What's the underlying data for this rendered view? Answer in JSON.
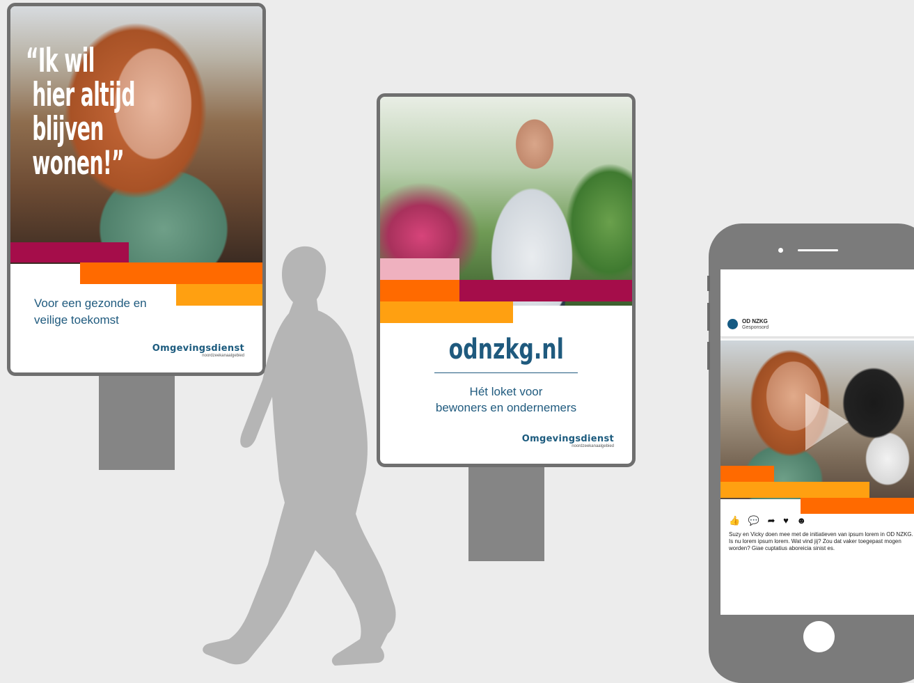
{
  "colors": {
    "background": "#ececec",
    "frame": "#6f6f6f",
    "post": "#858585",
    "brand_blue": "#1f5a7e",
    "magenta": "#a50d4a",
    "orange": "#ff6a00",
    "amber": "#ffa011",
    "pink": "#efb1bf"
  },
  "billboard_left": {
    "quote": "“Ik wil\n hier altijd\n blijven\n wonen!”",
    "tagline_line1": "Voor een gezonde en",
    "tagline_line2": "veilige toekomst",
    "logo": "Omgevingsdienst",
    "logo_sub": "noordzeekanaalgebied"
  },
  "billboard_middle": {
    "url": "odnzkg.nl",
    "sub_line1": "Hét loket voor",
    "sub_line2": "bewoners en ondernemers",
    "logo": "Omgevingsdienst",
    "logo_sub": "noordzeekanaalgebied"
  },
  "phone_post": {
    "account_name": "OD NZKG",
    "sponsored": "Gesponsord",
    "reaction_icons": [
      "thumbs-up-icon",
      "comment-icon",
      "share-icon",
      "heart-icon",
      "smiley-icon"
    ],
    "icons_text": "👍 💬 ➦ ♥ ☻",
    "caption": "Suzy en Vicky doen mee met de initiatieven van ipsum lorem in OD NZKG. Is nu lorem ipsum lorem. Wat vind jij? Zou dat vaker toegepast mogen worden? Giae cuptatius aboreicia sinist es."
  }
}
